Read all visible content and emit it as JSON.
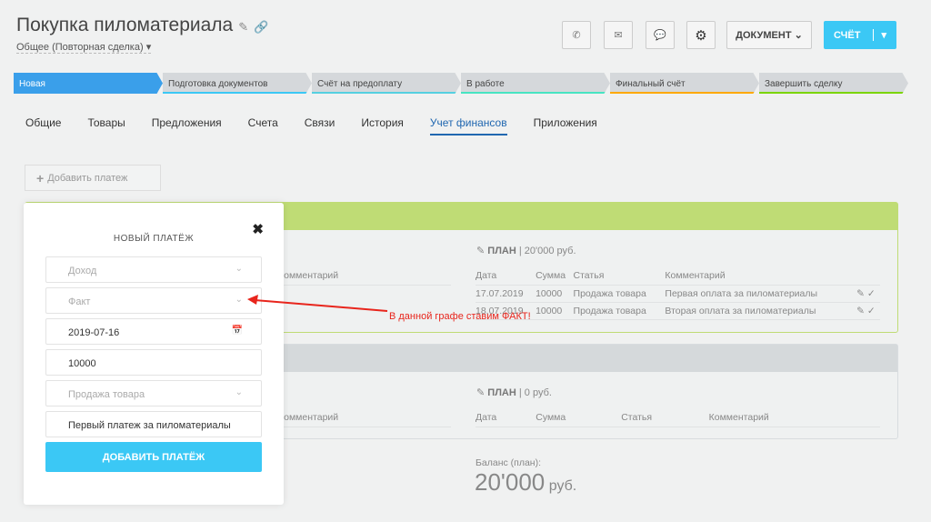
{
  "header": {
    "title": "Покупка пиломатериала",
    "subtitle": "Общее (Повторная сделка)",
    "document_label": "ДОКУМЕНТ",
    "bill_label": "СЧЁТ"
  },
  "stages": [
    {
      "label": "Новая",
      "color": "#3a9fea"
    },
    {
      "label": "Подготовка документов",
      "color": "#3bc8f5"
    },
    {
      "label": "Счёт на предоплату",
      "color": "#55d0e0"
    },
    {
      "label": "В работе",
      "color": "#47e4c2"
    },
    {
      "label": "Финальный счёт",
      "color": "#ffa900"
    },
    {
      "label": "Завершить сделку",
      "color": "#7bd500"
    }
  ],
  "tabs": [
    "Общие",
    "Товары",
    "Предложения",
    "Счета",
    "Связи",
    "История",
    "Учет финансов",
    "Приложения"
  ],
  "active_tab": "Учет финансов",
  "add_payment": "Добавить платеж",
  "income": {
    "plan_label": "ПЛАН",
    "plan_sum": "20'000 руб.",
    "fact_comment_header": "Комментарий",
    "columns": [
      "Дата",
      "Сумма",
      "Статья",
      "Комментарий"
    ],
    "rows": [
      [
        "17.07.2019",
        "10000",
        "Продажа товара",
        "Первая оплата за пиломатериалы"
      ],
      [
        "18.07.2019",
        "10000",
        "Продажа товара",
        "Вторая оплата за пиломатериалы"
      ]
    ]
  },
  "expense": {
    "plan_label": "ПЛАН",
    "plan_sum": "0 руб.",
    "fact_comment_header": "Комментарий",
    "columns": [
      "Дата",
      "Сумма",
      "Статья",
      "Комментарий"
    ]
  },
  "balance": {
    "label": "Баланс (план):",
    "value": "20'000",
    "unit": "руб."
  },
  "modal": {
    "title": "НОВЫЙ ПЛАТЁЖ",
    "type": "Доход",
    "kind": "Факт",
    "date": "2019-07-16",
    "amount": "10000",
    "category": "Продажа товара",
    "comment": "Первый платеж за пиломатериалы",
    "submit": "ДОБАВИТЬ ПЛАТЁЖ"
  },
  "annotation": "В данной графе ставим ФАКТ!"
}
